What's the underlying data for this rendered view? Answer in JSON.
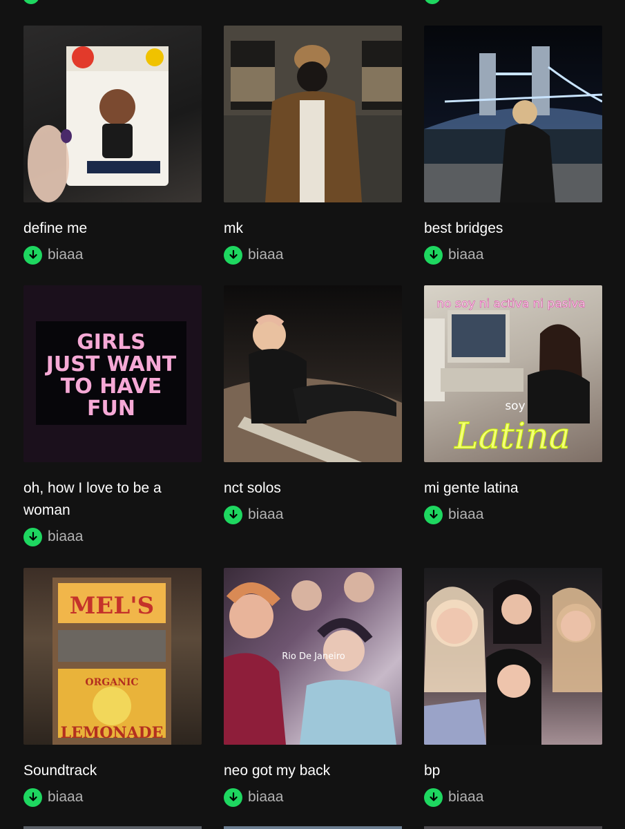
{
  "playlists": [
    {
      "title": "define me",
      "owner": "biaaa"
    },
    {
      "title": "mk",
      "owner": "biaaa"
    },
    {
      "title": "best bridges",
      "owner": "biaaa"
    },
    {
      "title": "oh, how I love to be a woman",
      "owner": "biaaa",
      "cover_text": "GIRLS JUST WANT TO HAVE FUN"
    },
    {
      "title": "nct solos",
      "owner": "biaaa"
    },
    {
      "title": "mi gente latina",
      "owner": "biaaa",
      "cover_text_1": "no soy ni activa ni pasiva",
      "cover_text_2": "soy",
      "cover_text_3": "Latina"
    },
    {
      "title": "Soundtrack",
      "owner": "biaaa",
      "cover_text_1": "MEL'S",
      "cover_text_2": "ORGANIC",
      "cover_text_3": "LEMONADE"
    },
    {
      "title": "neo got my back",
      "owner": "biaaa",
      "cover_text": "Rio De Janeiro"
    },
    {
      "title": "bp",
      "owner": "biaaa"
    }
  ],
  "colors": {
    "background": "#121212",
    "accent_green": "#1ed760",
    "secondary_text": "#b3b3b3"
  },
  "icons": {
    "download": "download-arrow-icon"
  }
}
